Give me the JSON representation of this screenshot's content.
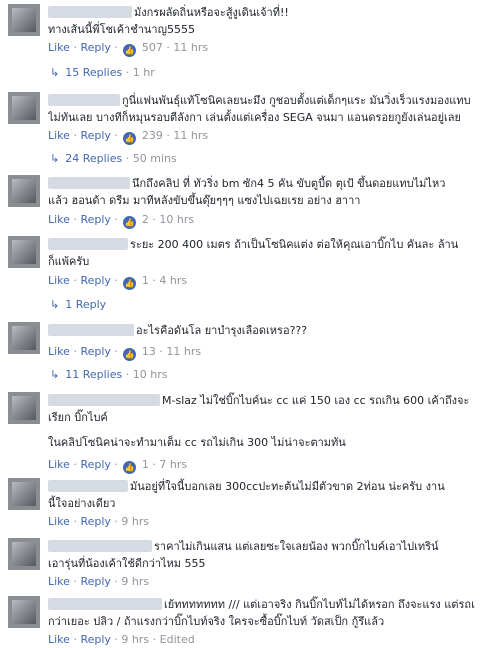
{
  "comments": [
    {
      "text1": "มังกรผลัดถิ่นหรือจะสู้งูเดินเจ้าที่!!",
      "text2": "ทางเส้นนี้พี่โชเค้าชำนาญ5555",
      "like": "Like",
      "reply": "Reply",
      "count": "507",
      "time": "11 hrs",
      "replies": "15 Replies",
      "replies_time": "1 hr"
    },
    {
      "text1": "กูนี่แฟนพันธุ์แท้โซนิคเลยนะมึง กูชอบตั้งแต่เด็กๆแระ มันวิ่งเร็วแรงมองแทบ",
      "text2": "ไม่ทันเลย บางทีก็หมุนรอบตีลังกา เล่นตั้งแต่เครื่อง SEGA จนมา แอนดรอยกูยังเล่นอยู่เลย",
      "like": "Like",
      "reply": "Reply",
      "count": "239",
      "time": "11 hrs",
      "replies": "24 Replies",
      "replies_time": "50 mins"
    },
    {
      "text1": "นึกถึงคลิป ที่ ทัวริ่ง bm ซัก4 5 คัน ขับตูบี้ด ตุเป้ ขึ้นดอยแทบไม่ไหว",
      "text2": "แล้ว ฮอนด้า ดรีม มาทีหลังขับขึ้นดุ๊ยๆๆๆ แซงไปเฉยเรย อย่าง ฮาาา",
      "like": "Like",
      "reply": "Reply",
      "count": "2",
      "time": "10 hrs"
    },
    {
      "text1": "ระยะ 200 400 เมตร ถ้าเป็นโซนิคแต่ง ต่อให้คุณเอาบิ๊กไบ คันละ ล้าน",
      "text2": "ก็แพ้ครับ",
      "like": "Like",
      "reply": "Reply",
      "count": "1",
      "time": "4 hrs",
      "replies": "1 Reply"
    },
    {
      "text1": "อะไรคือดันโล ยาบำรุงเลือดเหรอ???",
      "like": "Like",
      "reply": "Reply",
      "count": "13",
      "time": "11 hrs",
      "replies": "11 Replies",
      "replies_time": "10 hrs"
    },
    {
      "text1": "M-slaz ไม่ใช่บิ๊กไบค์นะ cc แค่ 150 เอง cc รถเกิน 600 เค้าถึงจะ",
      "text2": "เรียก บิ๊กไบค์",
      "text3": "ในคลิปโซนิคน่าจะทำมาเต็ม cc รถไม่เกิน 300 ไม่น่าจะตามทัน",
      "like": "Like",
      "reply": "Reply",
      "count": "1",
      "time": "7 hrs"
    },
    {
      "text1": "มันอยู่ที่ใจนี้บอกเลย 300ccปะทะต้นไม่มีตัวขาด 2ท่อน น่ะครับ งาน",
      "text2": "นี้ใจอย่างเดียว",
      "like": "Like",
      "reply": "Reply",
      "time": "9 hrs"
    },
    {
      "text1": "ราคาไม่เกินแสน แต่เลยซะใจเลยน้อง พวกบิ๊กไบค์เอาไปเทริน์",
      "text2": "เอารุ่นที่น้องเค้าใช้ดีกว่าไหม 555",
      "like": "Like",
      "reply": "Reply",
      "time": "9 hrs"
    },
    {
      "text1": "เย้ททททททท /// แต่เอาจริง กินบิ๊กไบท์ไม่ได้หรอก ถึงจะแรง แต่รถเบา",
      "text2": "กว่าเยอะ ปลิว / ถ้าแรงกว่าบิ๊กไบท์จริง ใครจะซื้อบิ๊กไบท์ วัดสเป็ก กู้รึแล้ว",
      "like": "Like",
      "reply": "Reply",
      "time": "9 hrs",
      "edited": "Edited"
    }
  ]
}
